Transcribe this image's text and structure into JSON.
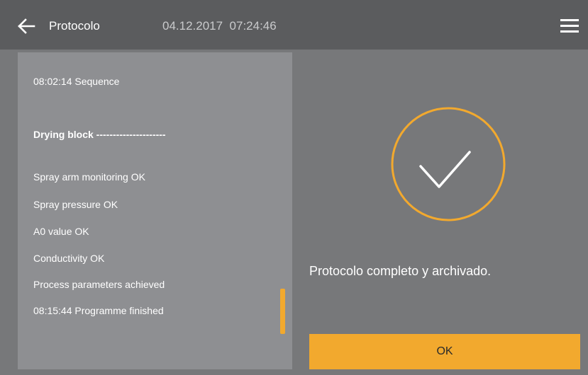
{
  "header": {
    "title": "Protocolo",
    "date": "04.12.2017",
    "time": "07:24:46"
  },
  "log": {
    "lines": [
      {
        "text": "08:02:14 Sequence",
        "bold": false
      },
      {
        "text": "Drying block ---------------------",
        "bold": true
      },
      {
        "text": "Spray arm monitoring OK",
        "bold": false
      },
      {
        "text": "Spray pressure OK",
        "bold": false
      },
      {
        "text": "A0 value OK",
        "bold": false
      },
      {
        "text": "Conductivity OK",
        "bold": false
      },
      {
        "text": "Process parameters achieved",
        "bold": false
      },
      {
        "text": "08:15:44 Programme finished",
        "bold": false
      }
    ]
  },
  "status": {
    "message": "Protocolo completo y archivado.",
    "ok_label": "OK"
  },
  "colors": {
    "accent": "#f2a92e",
    "header_bg": "#5b5c5e",
    "panel_bg": "#8e8f92",
    "body_bg": "#77787a"
  },
  "icons": {
    "back": "arrow-left-icon",
    "menu": "hamburger-menu-icon",
    "success": "checkmark-circle-icon"
  }
}
